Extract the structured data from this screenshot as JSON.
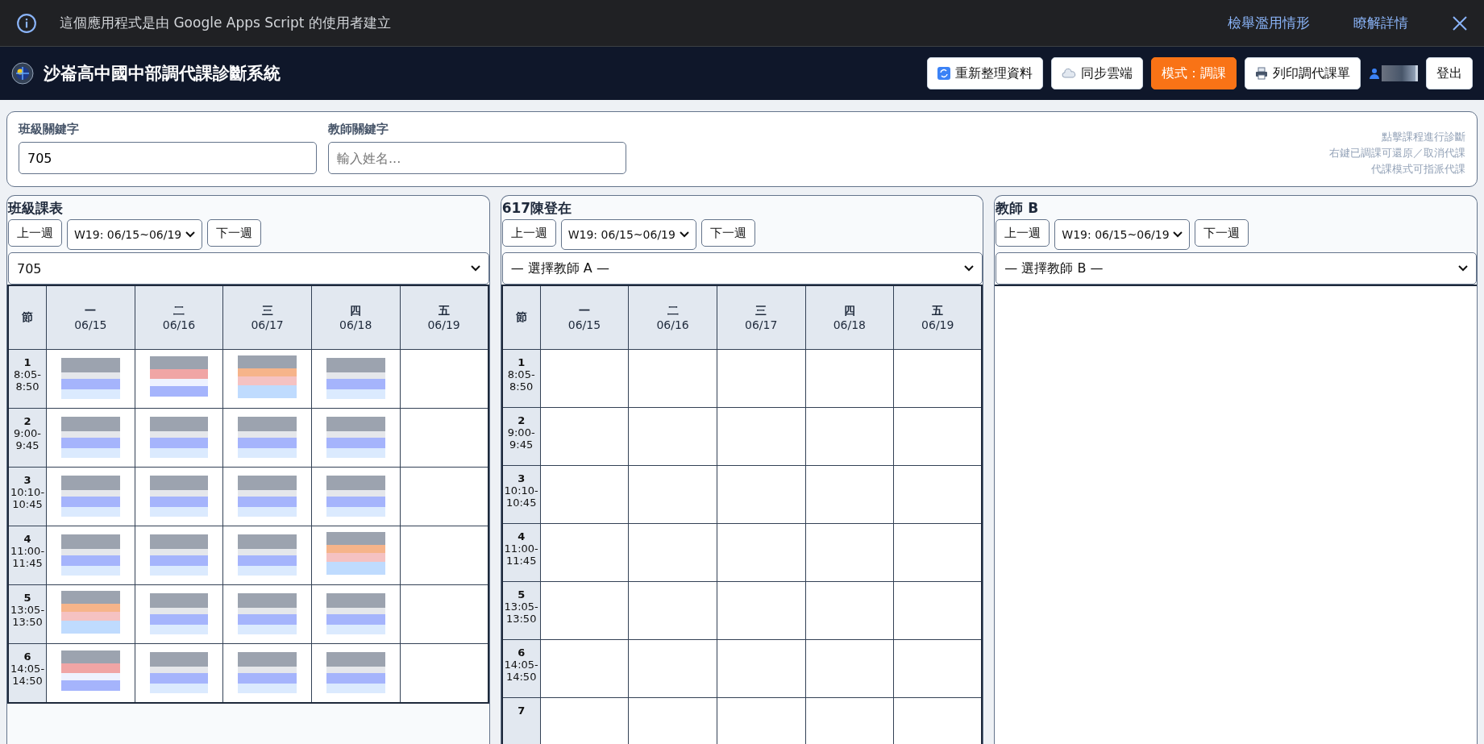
{
  "banner": {
    "message": "這個應用程式是由 Google Apps Script 的使用者建立",
    "links": [
      "檢舉濫用情形",
      "瞭解詳情"
    ]
  },
  "header": {
    "title": "沙崙高中國中部調代課診斷系統",
    "buttons": [
      {
        "kind": "plain",
        "label": "重新整理資料"
      },
      {
        "kind": "plain",
        "label": "同步雲端"
      },
      {
        "kind": "mode",
        "label": "模式：調課"
      },
      {
        "kind": "plain",
        "label": "列印調代課單"
      }
    ],
    "logout": "登出"
  },
  "filters": [
    {
      "label": "班級關鍵字",
      "value": "705"
    },
    {
      "label": "教師關鍵字",
      "placeholder": "輸入姓名..."
    }
  ],
  "hints": [
    "點擊課程進行診斷",
    "右鍵已調課可還原／取消代課",
    "代課模式可指派代課"
  ],
  "panels": [
    {
      "title": "班級課表",
      "prev": "上一週",
      "week": "W19: 06/15~06/19",
      "next": "下一週",
      "select": "705",
      "show_table": true,
      "corner": "節",
      "days": [
        {
          "day": "一",
          "date": "06/15"
        },
        {
          "day": "二",
          "date": "06/16"
        },
        {
          "day": "三",
          "date": "06/17"
        },
        {
          "day": "四",
          "date": "06/18"
        },
        {
          "day": "五",
          "date": "06/19"
        }
      ],
      "periods": [
        {
          "n": "1",
          "time": "8:05-8:50",
          "cells": [
            {
              "filled": true,
              "conflict": false,
              "warn": false
            },
            {
              "filled": true,
              "conflict": true,
              "warn": false
            },
            {
              "filled": true,
              "conflict": false,
              "warn": true
            },
            {
              "filled": true,
              "conflict": false,
              "warn": false
            },
            {
              "filled": false
            }
          ]
        },
        {
          "n": "2",
          "time": "9:00-9:45",
          "cells": [
            {
              "filled": true,
              "conflict": false,
              "warn": false
            },
            {
              "filled": true,
              "conflict": false,
              "warn": false
            },
            {
              "filled": true,
              "conflict": false,
              "warn": false
            },
            {
              "filled": true,
              "conflict": false,
              "warn": false
            },
            {
              "filled": false
            }
          ]
        },
        {
          "n": "3",
          "time": "10:10-10:45",
          "cells": [
            {
              "filled": true,
              "conflict": false,
              "warn": false
            },
            {
              "filled": true,
              "conflict": false,
              "warn": false
            },
            {
              "filled": true,
              "conflict": false,
              "warn": false
            },
            {
              "filled": true,
              "conflict": false,
              "warn": false
            },
            {
              "filled": false
            }
          ]
        },
        {
          "n": "4",
          "time": "11:00-11:45",
          "cells": [
            {
              "filled": true,
              "conflict": false,
              "warn": false
            },
            {
              "filled": true,
              "conflict": false,
              "warn": false
            },
            {
              "filled": true,
              "conflict": false,
              "warn": false
            },
            {
              "filled": true,
              "conflict": false,
              "warn": true
            },
            {
              "filled": false
            }
          ]
        },
        {
          "n": "5",
          "time": "13:05-13:50",
          "cells": [
            {
              "filled": true,
              "conflict": false,
              "warn": true
            },
            {
              "filled": true,
              "conflict": false,
              "warn": false
            },
            {
              "filled": true,
              "conflict": false,
              "warn": false
            },
            {
              "filled": true,
              "conflict": false,
              "warn": false
            },
            {
              "filled": false
            }
          ]
        },
        {
          "n": "6",
          "time": "14:05-14:50",
          "cells": [
            {
              "filled": true,
              "conflict": true,
              "warn": false
            },
            {
              "filled": true,
              "conflict": false,
              "warn": false
            },
            {
              "filled": true,
              "conflict": false,
              "warn": false
            },
            {
              "filled": true,
              "conflict": false,
              "warn": false
            },
            {
              "filled": false
            }
          ]
        }
      ]
    },
    {
      "title": "617陳登在",
      "prev": "上一週",
      "week": "W19: 06/15~06/19",
      "next": "下一週",
      "select": "— 選擇教師 A —",
      "show_table": true,
      "corner": "節",
      "days": [
        {
          "day": "一",
          "date": "06/15"
        },
        {
          "day": "二",
          "date": "06/16"
        },
        {
          "day": "三",
          "date": "06/17"
        },
        {
          "day": "四",
          "date": "06/18"
        },
        {
          "day": "五",
          "date": "06/19"
        }
      ],
      "periods": [
        {
          "n": "1",
          "time": "8:05-8:50",
          "cells": [
            {
              "filled": false
            },
            {
              "filled": false
            },
            {
              "filled": false
            },
            {
              "filled": false
            },
            {
              "filled": false
            }
          ]
        },
        {
          "n": "2",
          "time": "9:00-9:45",
          "cells": [
            {
              "filled": false
            },
            {
              "filled": false
            },
            {
              "filled": false
            },
            {
              "filled": false
            },
            {
              "filled": false
            }
          ]
        },
        {
          "n": "3",
          "time": "10:10-10:45",
          "cells": [
            {
              "filled": false
            },
            {
              "filled": false
            },
            {
              "filled": false
            },
            {
              "filled": false
            },
            {
              "filled": false
            }
          ]
        },
        {
          "n": "4",
          "time": "11:00-11:45",
          "cells": [
            {
              "filled": false
            },
            {
              "filled": false
            },
            {
              "filled": false
            },
            {
              "filled": false
            },
            {
              "filled": false
            }
          ]
        },
        {
          "n": "5",
          "time": "13:05-13:50",
          "cells": [
            {
              "filled": false
            },
            {
              "filled": false
            },
            {
              "filled": false
            },
            {
              "filled": false
            },
            {
              "filled": false
            }
          ]
        },
        {
          "n": "6",
          "time": "14:05-14:50",
          "cells": [
            {
              "filled": false
            },
            {
              "filled": false
            },
            {
              "filled": false
            },
            {
              "filled": false
            },
            {
              "filled": false
            }
          ]
        },
        {
          "n": "7",
          "cells": [
            {
              "filled": false
            },
            {
              "filled": false
            },
            {
              "filled": false
            },
            {
              "filled": false
            },
            {
              "filled": false
            }
          ]
        }
      ]
    },
    {
      "title": "教師 B",
      "prev": "上一週",
      "week": "W19: 06/15~06/19",
      "next": "下一週",
      "select": "— 選擇教師 B —",
      "show_table": false
    }
  ]
}
